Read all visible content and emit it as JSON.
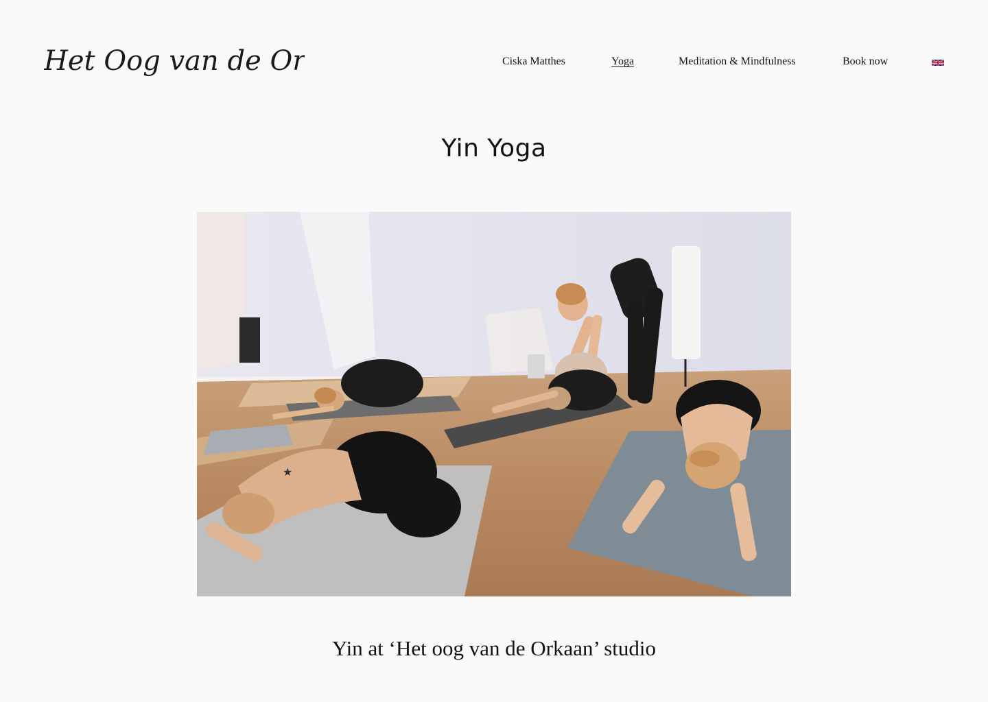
{
  "header": {
    "logo_text": "Het Oog van de Orkaan",
    "nav": [
      {
        "label": "Ciska Matthes",
        "active": false
      },
      {
        "label": "Yoga",
        "active": true
      },
      {
        "label": "Meditation & Mindfulness",
        "active": false
      },
      {
        "label": "Book now",
        "active": false
      }
    ],
    "language_flag_icon": "uk-flag-icon"
  },
  "main": {
    "title": "Yin Yoga",
    "hero_image": {
      "subject": "yoga-class-photo"
    },
    "caption": "Yin at ‘Het oog van de Orkaan’ studio"
  },
  "colors": {
    "background": "#fafafa",
    "text": "#111111"
  }
}
